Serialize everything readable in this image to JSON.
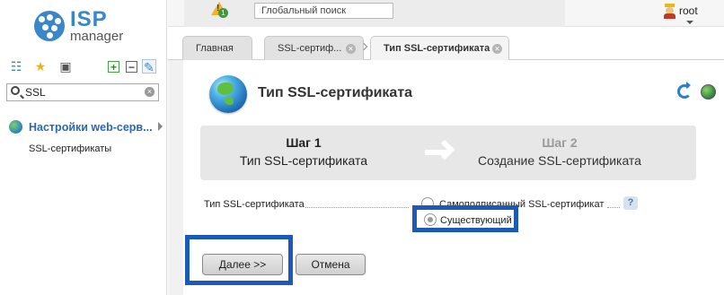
{
  "app": {
    "logo_text": "ISP",
    "logo_subtext": "manager"
  },
  "sidebar": {
    "search_value": "SSL",
    "group_label": "Настройки web-серв...",
    "item_label": "SSL-сертификаты"
  },
  "topbar": {
    "notifications_count": "1",
    "global_search_placeholder": "Глобальный поиск",
    "user_name": "root"
  },
  "tabs": [
    {
      "label": "Главная"
    },
    {
      "label": "SSL-сертиф..."
    },
    {
      "label": "Тип SSL-сертификата"
    }
  ],
  "page": {
    "title": "Тип SSL-сертификата"
  },
  "wizard": {
    "step1_number": "Шаг 1",
    "step1_label": "Тип SSL-сертификата",
    "step2_number": "Шаг 2",
    "step2_label": "Создание SSL-сертификата"
  },
  "form": {
    "field_label": "Тип SSL-сертификата",
    "option_self_signed": "Самоподписанный SSL-сертификат",
    "option_existing": "Существующий",
    "selected": "option_existing",
    "help_label": "?"
  },
  "buttons": {
    "next": "Далее >>",
    "cancel": "Отмена"
  }
}
